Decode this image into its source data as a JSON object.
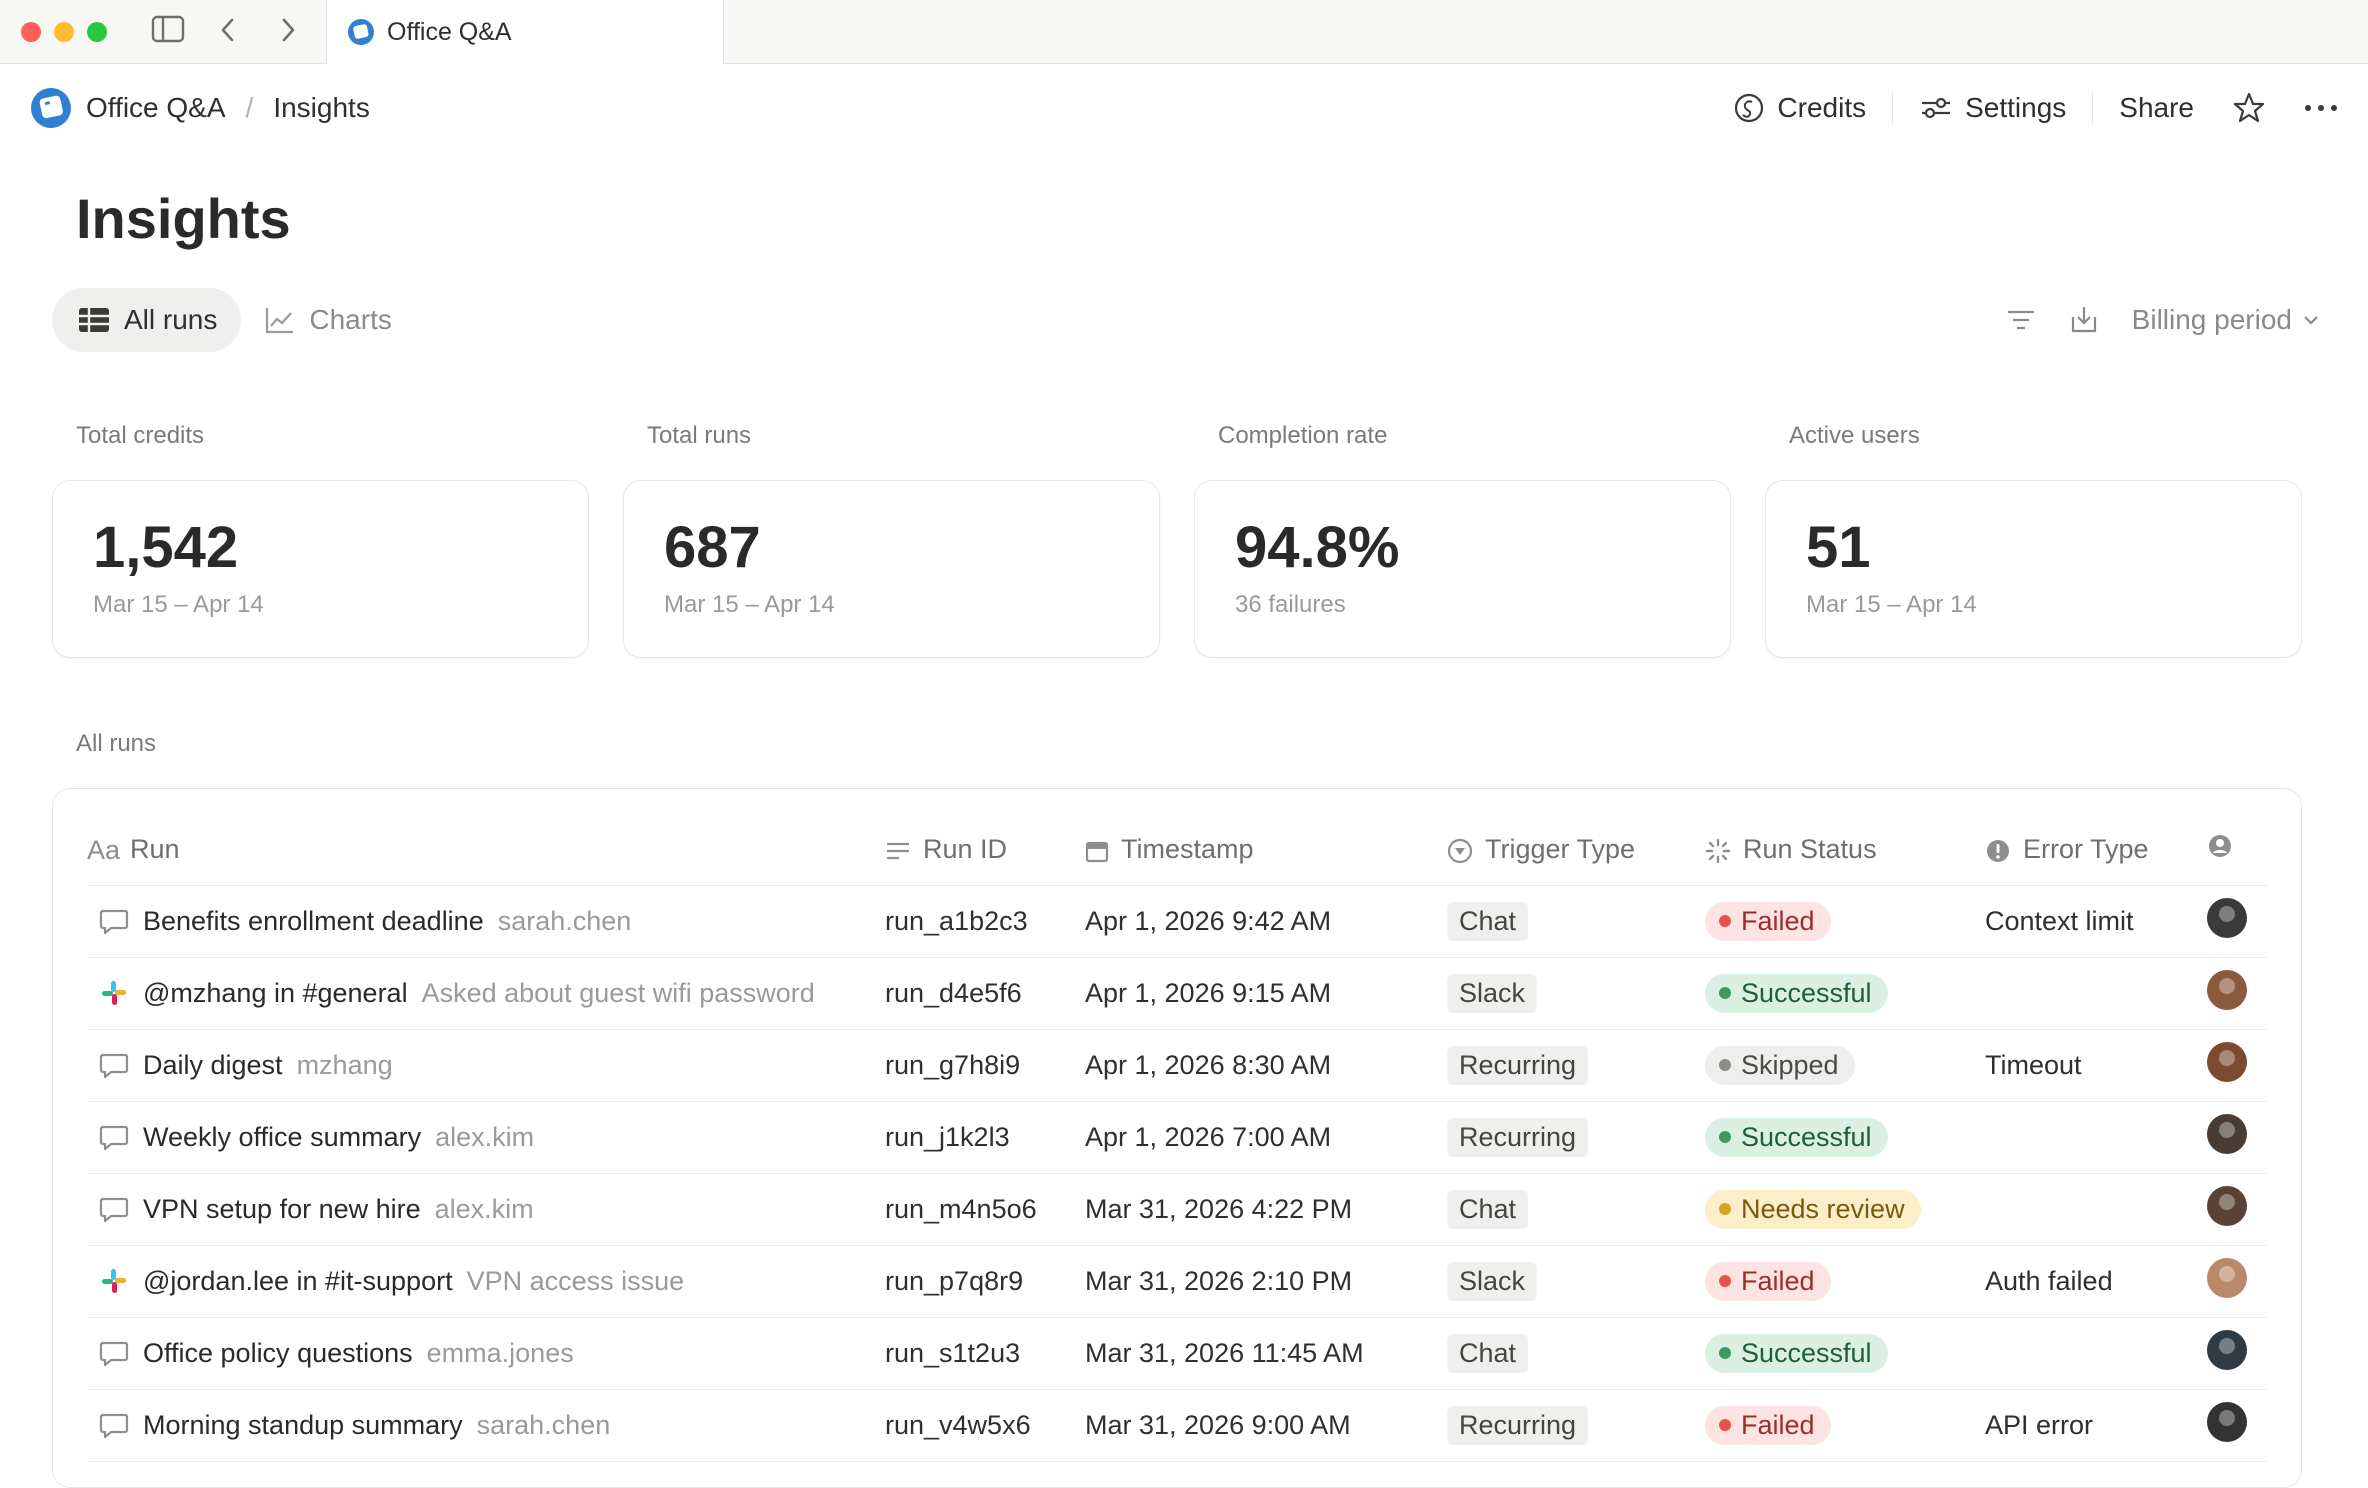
{
  "window": {
    "tab_title": "Office Q&A"
  },
  "breadcrumb": {
    "app": "Office Q&A",
    "page": "Insights"
  },
  "actions": {
    "credits": "Credits",
    "settings": "Settings",
    "share": "Share"
  },
  "page_title": "Insights",
  "views": {
    "all_runs": "All runs",
    "charts": "Charts",
    "billing_period": "Billing period"
  },
  "stats": [
    {
      "label": "Total credits",
      "value": "1,542",
      "sub": "Mar 15 – Apr 14"
    },
    {
      "label": "Total runs",
      "value": "687",
      "sub": "Mar 15 – Apr 14"
    },
    {
      "label": "Completion rate",
      "value": "94.8%",
      "sub": "36 failures"
    },
    {
      "label": "Active users",
      "value": "51",
      "sub": "Mar 15 – Apr 14"
    }
  ],
  "section_label": "All runs",
  "table": {
    "headers": {
      "run_prefix": "Aa",
      "run": "Run",
      "run_id": "Run ID",
      "timestamp": "Timestamp",
      "trigger": "Trigger Type",
      "status": "Run Status",
      "error": "Error Type"
    },
    "rows": [
      {
        "icon": "chat",
        "title": "Benefits enrollment deadline",
        "sub": "sarah.chen",
        "run_id": "run_a1b2c3",
        "timestamp": "Apr 1, 2026 9:42 AM",
        "trigger": "Chat",
        "status": "Failed",
        "error": "Context limit",
        "avatar": "#3a3a3a"
      },
      {
        "icon": "slack",
        "title": "@mzhang in #general",
        "sub": "Asked about guest wifi password",
        "run_id": "run_d4e5f6",
        "timestamp": "Apr 1, 2026 9:15 AM",
        "trigger": "Slack",
        "status": "Successful",
        "error": "",
        "avatar": "#8a5a3c"
      },
      {
        "icon": "chat",
        "title": "Daily digest",
        "sub": "mzhang",
        "run_id": "run_g7h8i9",
        "timestamp": "Apr 1, 2026 8:30 AM",
        "trigger": "Recurring",
        "status": "Skipped",
        "error": "Timeout",
        "avatar": "#7c4a30"
      },
      {
        "icon": "chat",
        "title": "Weekly office summary",
        "sub": "alex.kim",
        "run_id": "run_j1k2l3",
        "timestamp": "Apr 1, 2026 7:00 AM",
        "trigger": "Recurring",
        "status": "Successful",
        "error": "",
        "avatar": "#4a3b33"
      },
      {
        "icon": "chat",
        "title": "VPN setup for new hire",
        "sub": "alex.kim",
        "run_id": "run_m4n5o6",
        "timestamp": "Mar 31, 2026 4:22 PM",
        "trigger": "Chat",
        "status": "Needs review",
        "error": "",
        "avatar": "#5a4234"
      },
      {
        "icon": "slack",
        "title": "@jordan.lee in #it-support",
        "sub": "VPN access issue",
        "run_id": "run_p7q8r9",
        "timestamp": "Mar 31, 2026 2:10 PM",
        "trigger": "Slack",
        "status": "Failed",
        "error": "Auth failed",
        "avatar": "#b88a6a"
      },
      {
        "icon": "chat",
        "title": "Office policy questions",
        "sub": "emma.jones",
        "run_id": "run_s1t2u3",
        "timestamp": "Mar 31, 2026 11:45 AM",
        "trigger": "Chat",
        "status": "Successful",
        "error": "",
        "avatar": "#2e3a44"
      },
      {
        "icon": "chat",
        "title": "Morning standup summary",
        "sub": "sarah.chen",
        "run_id": "run_v4w5x6",
        "timestamp": "Mar 31, 2026 9:00 AM",
        "trigger": "Recurring",
        "status": "Failed",
        "error": "API error",
        "avatar": "#333333"
      }
    ]
  },
  "status_colors": {
    "Failed": {
      "bg": "#fde4e2",
      "dot": "#e5534b",
      "text": "#9b2c2c"
    },
    "Successful": {
      "bg": "#dcefe3",
      "dot": "#3c9b5f",
      "text": "#1f5e37"
    },
    "Skipped": {
      "bg": "#eeeeec",
      "dot": "#8d8d8b",
      "text": "#4a4a48"
    },
    "Needs review": {
      "bg": "#fbeec8",
      "dot": "#d9a520",
      "text": "#7a5a10"
    }
  }
}
